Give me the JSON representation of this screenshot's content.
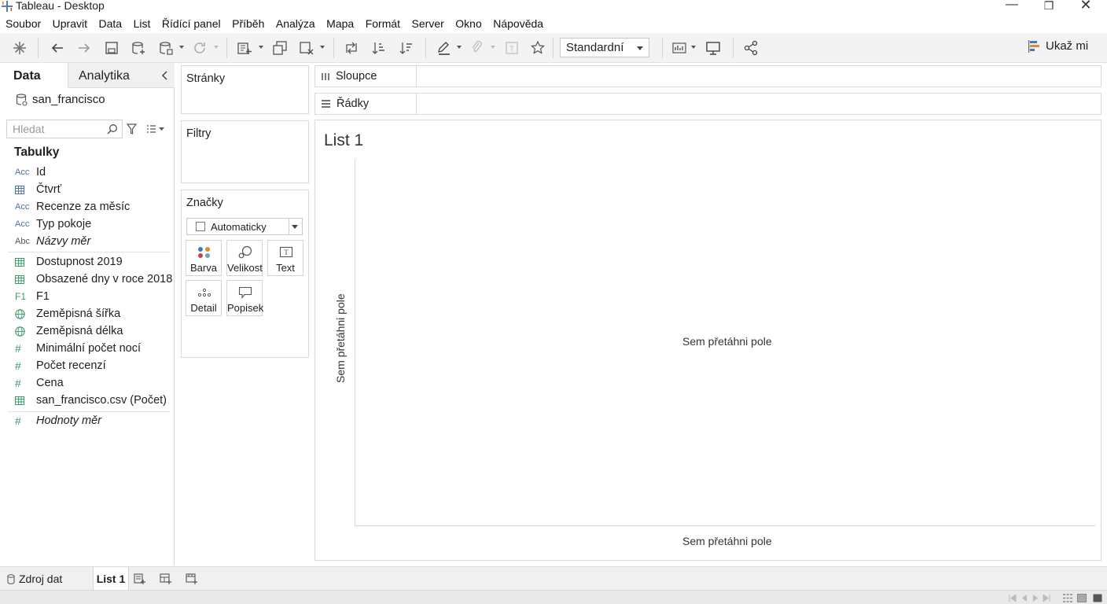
{
  "window": {
    "title": "Tableau - Desktop"
  },
  "menu": [
    "Soubor",
    "Upravit",
    "Data",
    "List",
    "Řídící panel",
    "Příběh",
    "Analýza",
    "Mapa",
    "Formát",
    "Server",
    "Okno",
    "Nápověda"
  ],
  "toolbar": {
    "mark_label_select": "Standardní",
    "show_me_label": "Ukaž mi"
  },
  "data_pane": {
    "tab_data": "Data",
    "tab_analytics": "Analytika",
    "datasource": "san_francisco",
    "search_placeholder": "Hledat",
    "tables_label": "Tabulky",
    "dimensions": [
      {
        "icon": "Acc",
        "label": "Id"
      },
      {
        "icon": "table",
        "label": "Čtvrť"
      },
      {
        "icon": "Acc",
        "label": "Recenze za měsíc"
      },
      {
        "icon": "Acc",
        "label": "Typ pokoje"
      },
      {
        "icon": "Abc",
        "label": "Názvy měr"
      }
    ],
    "measures": [
      {
        "icon": "table",
        "label": "Dostupnost 2019"
      },
      {
        "icon": "table",
        "label": "Obsazené dny v roce 2018"
      },
      {
        "icon": "F1",
        "label": "F1"
      },
      {
        "icon": "globe",
        "label": "Zeměpisná šířka"
      },
      {
        "icon": "globe",
        "label": "Zeměpisná délka"
      },
      {
        "icon": "#",
        "label": "Minimální počet nocí"
      },
      {
        "icon": "#",
        "label": "Počet recenzí"
      },
      {
        "icon": "#",
        "label": "Cena"
      },
      {
        "icon": "table",
        "label": "san_francisco.csv (Počet)"
      },
      {
        "icon": "#",
        "label": "Hodnoty měr"
      }
    ]
  },
  "cards": {
    "pages": "Stránky",
    "filters": "Filtry",
    "marks": "Značky",
    "mark_type": "Automaticky",
    "mark_buttons": [
      "Barva",
      "Velikost",
      "Text",
      "Detail",
      "Popisek"
    ]
  },
  "shelves": {
    "columns": "Sloupce",
    "rows": "Řádky"
  },
  "canvas": {
    "sheet_title": "List 1",
    "drop_center": "Sem přetáhni pole",
    "drop_x": "Sem přetáhni pole",
    "drop_y": "Sem přetáhni pole"
  },
  "sheet_tabs": {
    "datasource_tab": "Zdroj dat",
    "active_sheet": "List 1"
  }
}
